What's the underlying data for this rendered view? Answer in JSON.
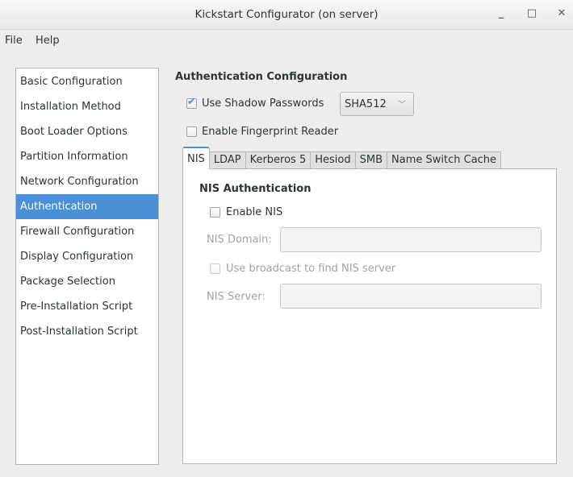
{
  "window": {
    "title": "Kickstart Configurator (on server)"
  },
  "menu": [
    "File",
    "Help"
  ],
  "sidebar": {
    "items": [
      "Basic Configuration",
      "Installation Method",
      "Boot Loader Options",
      "Partition Information",
      "Network Configuration",
      "Authentication",
      "Firewall Configuration",
      "Display Configuration",
      "Package Selection",
      "Pre-Installation Script",
      "Post-Installation Script"
    ],
    "selected": "Authentication"
  },
  "auth": {
    "heading": "Authentication Configuration",
    "shadow_label": "Use Shadow Passwords",
    "shadow_checked": true,
    "hash": "SHA512",
    "fingerprint_label": "Enable Fingerprint Reader",
    "fingerprint_checked": false,
    "tabs": [
      "NIS",
      "LDAP",
      "Kerberos 5",
      "Hesiod",
      "SMB",
      "Name Switch Cache"
    ],
    "active_tab": "NIS",
    "nis": {
      "heading": "NIS Authentication",
      "enable_label": "Enable NIS",
      "domain_label": "NIS Domain:",
      "domain_value": "",
      "broadcast_label": "Use broadcast to find NIS server",
      "server_label": "NIS Server:",
      "server_value": ""
    }
  },
  "colors": {
    "accent": "#4a90d9"
  }
}
